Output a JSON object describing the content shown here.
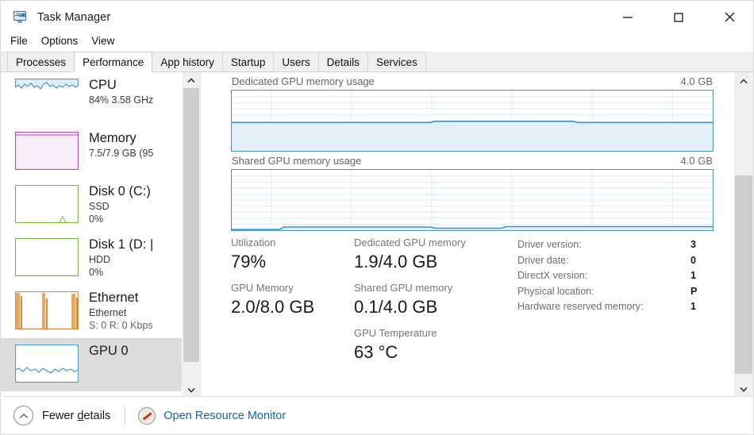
{
  "window": {
    "title": "Task Manager",
    "icon": "task-manager-icon",
    "minimize_label": "—",
    "maximize_label": "□",
    "close_label": "✕"
  },
  "menu": {
    "items": [
      {
        "label": "File"
      },
      {
        "label": "Options"
      },
      {
        "label": "View"
      }
    ]
  },
  "tabs": {
    "active": "Performance",
    "items": [
      {
        "label": "Processes"
      },
      {
        "label": "Performance"
      },
      {
        "label": "App history"
      },
      {
        "label": "Startup"
      },
      {
        "label": "Users"
      },
      {
        "label": "Details"
      },
      {
        "label": "Services"
      }
    ]
  },
  "sidebar": {
    "items": [
      {
        "name": "CPU",
        "title": "CPU",
        "line1": "84%  3.58 GHz",
        "line2": "",
        "line3": "",
        "color": "#4a9fd0",
        "fill": "#ddeef8",
        "selected": false
      },
      {
        "name": "Memory",
        "title": "Memory",
        "line1": "7.5/7.9 GB (95",
        "line2": "",
        "line3": "",
        "color": "#b44ac0",
        "fill": "#f7ecf8",
        "selected": false
      },
      {
        "name": "Disk 0 (C:)",
        "title": "Disk 0 (C:)",
        "line1": "SSD",
        "line2": "0%",
        "line3": "",
        "color": "#76bb45",
        "fill": "#ffffff",
        "selected": false
      },
      {
        "name": "Disk 1 (D:)",
        "title": "Disk 1 (D: |",
        "line1": "HDD",
        "line2": "0%",
        "line3": "",
        "color": "#76bb45",
        "fill": "#ffffff",
        "selected": false
      },
      {
        "name": "Ethernet",
        "title": "Ethernet",
        "line1": "Ethernet",
        "line2": "S: 0 R: 0 Kbps",
        "line3": "",
        "color": "#d98b3f",
        "fill": "#ffffff",
        "selected": false
      },
      {
        "name": "GPU 0",
        "title": "GPU 0",
        "line1": "",
        "line2": "",
        "line3": "",
        "color": "#4a9fd0",
        "fill": "#ffffff",
        "selected": true
      }
    ],
    "scroll_up_icon": "chevron-up-icon",
    "scroll_down_icon": "chevron-down-icon"
  },
  "main": {
    "graphs": [
      {
        "title": "Dedicated GPU memory usage",
        "max_label": "4.0 GB",
        "fill_ratio": 0.47
      },
      {
        "title": "Shared GPU memory usage",
        "max_label": "4.0 GB",
        "fill_ratio": 0.025
      }
    ],
    "stats": {
      "col1": [
        {
          "label": "Utilization",
          "value": "79%"
        },
        {
          "label": "GPU Memory",
          "value": "2.0/8.0 GB"
        }
      ],
      "col2": [
        {
          "label": "Dedicated GPU memory",
          "value": "1.9/4.0 GB"
        },
        {
          "label": "Shared GPU memory",
          "value": "0.1/4.0 GB"
        },
        {
          "label": "GPU Temperature",
          "value": "63 °C"
        }
      ]
    },
    "info": [
      {
        "key": "Driver version:",
        "value": "3"
      },
      {
        "key": "Driver date:",
        "value": "0"
      },
      {
        "key": "DirectX version:",
        "value": "1"
      },
      {
        "key": "Physical location:",
        "value": "P"
      },
      {
        "key": "Hardware reserved memory:",
        "value": "1"
      }
    ],
    "scroll_up_icon": "chevron-up-icon",
    "scroll_down_icon": "chevron-down-icon"
  },
  "statusbar": {
    "fewer_details_pre": "Fewer ",
    "fewer_details_accel": "d",
    "fewer_details_post": "etails",
    "collapse_icon": "chevron-up-circle-icon",
    "resource_monitor_icon": "resource-monitor-icon",
    "resource_monitor_label": "Open Resource Monitor",
    "link_color": "#1464b4"
  }
}
